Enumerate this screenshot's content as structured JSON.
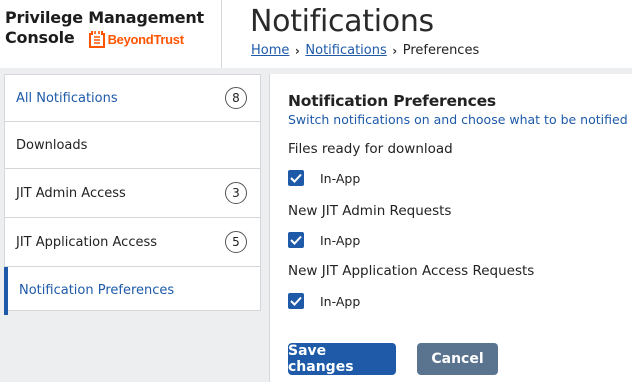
{
  "header": {
    "brand_line1": "Privilege Management",
    "brand_line2": "Console",
    "brand_logo_text": "BeyondTrust",
    "page_title": "Notifications",
    "breadcrumb": [
      {
        "label": "Home"
      },
      {
        "label": "Notifications"
      },
      {
        "label": "Preferences"
      }
    ]
  },
  "sidebar": {
    "items": [
      {
        "label": "All Notifications",
        "count": "8"
      },
      {
        "label": "Downloads"
      },
      {
        "label": "JIT Admin Access",
        "count": "3"
      },
      {
        "label": "JIT Application Access",
        "count": "5"
      },
      {
        "label": "Notification Preferences"
      }
    ]
  },
  "main": {
    "title": "Notification Preferences",
    "subtitle": "Switch notifications on and choose what to be notified of.",
    "groups": [
      {
        "label": "Files ready for download",
        "option": "In-App",
        "checked": true
      },
      {
        "label": "New JIT Admin Requests",
        "option": "In-App",
        "checked": true
      },
      {
        "label": "New JIT Application Access Requests",
        "option": "In-App",
        "checked": true
      }
    ],
    "save_label": "Save changes",
    "cancel_label": "Cancel"
  },
  "colors": {
    "accent": "#1e5aa8",
    "brand_orange": "#ff5500",
    "secondary_button": "#5a7490",
    "background": "#edeef0"
  },
  "icons": {
    "brand_logo": "beyondtrust-logo-icon",
    "breadcrumb_separator": "chevron-right-icon",
    "checkbox": "checkmark-icon"
  }
}
